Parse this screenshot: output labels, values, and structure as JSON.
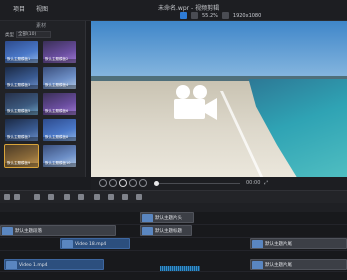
{
  "menu": {
    "items": [
      "",
      "项目",
      "视图"
    ]
  },
  "window": {
    "title": "未命名.wpr - 视频剪辑"
  },
  "toolbar": {
    "zoom_label": "55.2%",
    "resolution": "1920x1080"
  },
  "media_panel": {
    "title": "素材",
    "filter_label": "类型",
    "filter_value": "全部(10)",
    "items": [
      {
        "label": "默认主题模板1"
      },
      {
        "label": "默认主题模板2"
      },
      {
        "label": "默认主题模板3"
      },
      {
        "label": "默认主题模板4"
      },
      {
        "label": "默认主题模板5"
      },
      {
        "label": "默认主题模板6"
      },
      {
        "label": "默认主题模板7"
      },
      {
        "label": "默认主题模板8"
      },
      {
        "label": "默认主题模板9"
      },
      {
        "label": "默认主题模板10"
      }
    ]
  },
  "transport": {
    "time": "00:00",
    "progress": 0.0
  },
  "timeline": {
    "ruler": [
      "",
      "",
      "",
      "",
      "",
      "",
      "",
      "",
      "",
      "",
      ""
    ],
    "clips": [
      {
        "label": "默认主题片头",
        "track": 0
      },
      {
        "label": "默认主题段落",
        "track": 1
      },
      {
        "label": "默认主题标题",
        "track": 1
      },
      {
        "label": "Video 18.mp4",
        "track": 2
      },
      {
        "label": "默认主题片尾",
        "track": 2
      },
      {
        "label": "Video 1.mp4",
        "track": 3
      },
      {
        "label": "默认主题片尾",
        "track": 3
      }
    ]
  }
}
